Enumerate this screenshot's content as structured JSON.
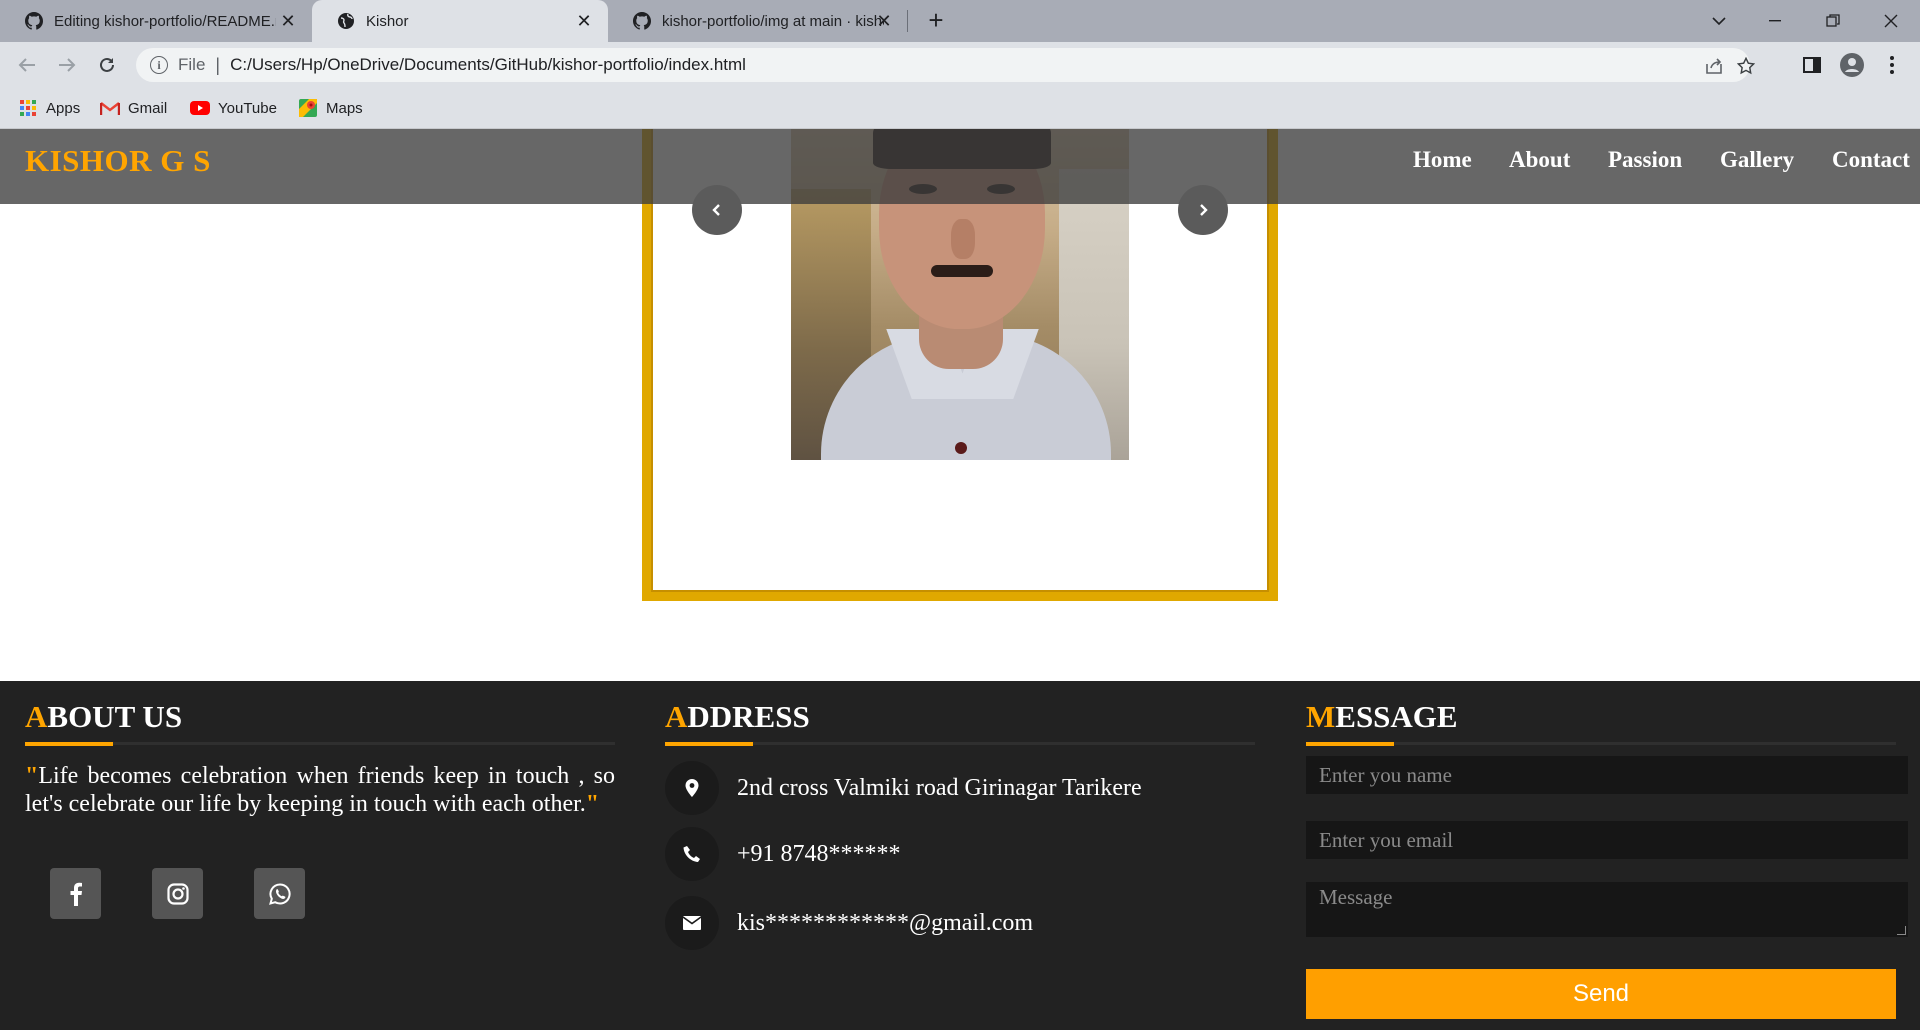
{
  "browser": {
    "tabs": [
      {
        "title": "Editing kishor-portfolio/README.md",
        "icon": "github-icon",
        "active": false
      },
      {
        "title": "Kishor",
        "icon": "globe-icon",
        "active": true
      },
      {
        "title": "kishor-portfolio/img at main · kishor",
        "icon": "github-icon",
        "active": false
      }
    ],
    "address": {
      "scheme": "File",
      "url": "C:/Users/Hp/OneDrive/Documents/GitHub/kishor-portfolio/index.html"
    },
    "bookmarks": [
      {
        "label": "Apps",
        "icon": "apps-grid-icon"
      },
      {
        "label": "Gmail",
        "icon": "gmail-icon"
      },
      {
        "label": "YouTube",
        "icon": "youtube-icon"
      },
      {
        "label": "Maps",
        "icon": "maps-icon"
      }
    ]
  },
  "site": {
    "brand": "KISHOR G S",
    "nav": [
      "Home",
      "About",
      "Passion",
      "Gallery",
      "Contact"
    ]
  },
  "footer": {
    "about": {
      "title_first": "A",
      "title_rest": "BOUT US",
      "quote_open": "\"",
      "quote": "Life becomes celebration when friends keep in touch , so let's celebrate our life by keeping in touch with each other.",
      "quote_close": "\"",
      "social": [
        "facebook-icon",
        "instagram-icon",
        "whatsapp-icon"
      ]
    },
    "address": {
      "title_first": "A",
      "title_rest": "DDRESS",
      "location": "2nd cross Valmiki road Girinagar Tarikere",
      "phone": "+91 8748******",
      "email": "kis************@gmail.com"
    },
    "message": {
      "title_first": "M",
      "title_rest": "ESSAGE",
      "name_placeholder": "Enter you name",
      "email_placeholder": "Enter you email",
      "message_placeholder": "Message",
      "send_label": "Send"
    }
  },
  "colors": {
    "accent": "#ffa500",
    "footer_bg": "#222222",
    "send_button": "#ff9f00",
    "frame": "#e0a800"
  }
}
